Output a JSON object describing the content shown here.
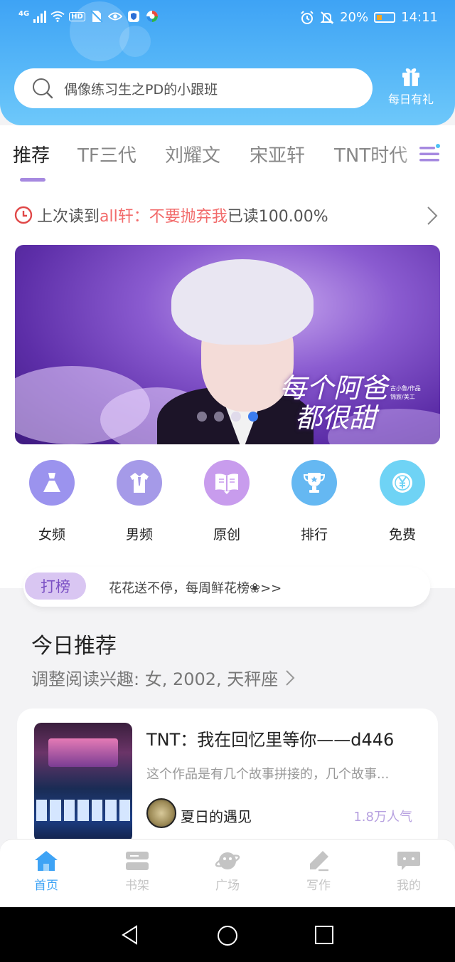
{
  "status_bar": {
    "network": "4G",
    "hd_label": "HD",
    "battery_percent": "20%",
    "time": "14:11"
  },
  "search": {
    "placeholder": "偶像练习生之PD的小跟班"
  },
  "daily_gift": {
    "label": "每日有礼"
  },
  "tabs": [
    {
      "label": "推荐",
      "active": true
    },
    {
      "label": "TF三代",
      "active": false
    },
    {
      "label": "刘耀文",
      "active": false
    },
    {
      "label": "宋亚轩",
      "active": false
    },
    {
      "label": "TNT时代",
      "active": false
    }
  ],
  "last_read": {
    "prefix": "上次读到",
    "title": "all轩：不要抛弃我",
    "suffix": "已读100.00%"
  },
  "banner": {
    "title_line1": "每个阿爸",
    "title_line2": "都很甜",
    "credit_line1": "古小鲁/作品",
    "credit_line2": "锦宸/美工",
    "slide_count": 4,
    "active_slide": 4
  },
  "categories": [
    {
      "label": "女频",
      "icon": "dress-icon",
      "color": "#9b93ee"
    },
    {
      "label": "男频",
      "icon": "shirt-icon",
      "color": "#a59ae8"
    },
    {
      "label": "原创",
      "icon": "book-icon",
      "color": "#c89ced"
    },
    {
      "label": "排行",
      "icon": "trophy-icon",
      "color": "#65b8f2"
    },
    {
      "label": "免费",
      "icon": "coin-icon",
      "color": "#6fd3f5"
    }
  ],
  "dabang": {
    "tag": "打榜",
    "text": "花花送不停，每周鲜花榜❀>>"
  },
  "today": {
    "title": "今日推荐",
    "subtitle": "调整阅读兴趣: 女, 2002, 天秤座"
  },
  "recommend_card": {
    "title": "TNT：我在回忆里等你——d446",
    "desc": "这个作品是有几个故事拼接的，几个故事...",
    "author": "夏日的遇见",
    "popularity": "1.8万人气"
  },
  "bottom_nav": [
    {
      "label": "首页",
      "icon": "home-icon",
      "active": true
    },
    {
      "label": "书架",
      "icon": "bookshelf-icon",
      "active": false
    },
    {
      "label": "广场",
      "icon": "planet-icon",
      "active": false
    },
    {
      "label": "写作",
      "icon": "pen-icon",
      "active": false
    },
    {
      "label": "我的",
      "icon": "chat-icon",
      "active": false
    }
  ],
  "colors": {
    "header_blue": "#3ea3f5",
    "accent_purple": "#a689e0",
    "highlight_red": "#f26b6b"
  }
}
